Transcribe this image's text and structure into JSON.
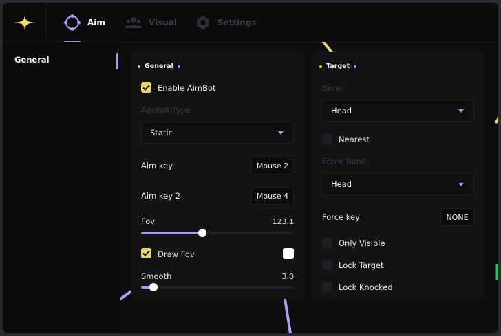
{
  "window": {
    "accent_color": "#a79de9",
    "check_color": "#e6d27a"
  },
  "tabs": [
    {
      "label": "Aim",
      "icon": "crosshair-icon",
      "active": true
    },
    {
      "label": "Visual",
      "icon": "users-icon",
      "active": false
    },
    {
      "label": "Settings",
      "icon": "gear-icon",
      "active": false
    }
  ],
  "sidebar": {
    "items": [
      {
        "label": "General",
        "active": true
      }
    ]
  },
  "general_panel": {
    "title": "General",
    "enable_aimbot": {
      "label": "Enable AimBot",
      "checked": true
    },
    "aimbot_type": {
      "label": "AimBot Type",
      "value": "Static"
    },
    "aim_key": {
      "label": "Aim key",
      "value": "Mouse 2"
    },
    "aim_key_2": {
      "label": "Aim key 2",
      "value": "Mouse 4"
    },
    "fov": {
      "label": "Fov",
      "value": "123.1",
      "fraction": 0.4
    },
    "draw_fov": {
      "label": "Draw Fov",
      "checked": true,
      "swatch_color": "#ffffff"
    },
    "smooth": {
      "label": "Smooth",
      "value": "3.0",
      "fraction": 0.08
    }
  },
  "target_panel": {
    "title": "Target",
    "bone": {
      "label": "Bone",
      "value": "Head"
    },
    "nearest": {
      "label": "Nearest",
      "checked": false
    },
    "force_bone": {
      "label": "Force Bone",
      "value": "Head"
    },
    "force_key": {
      "label": "Force key",
      "value": "NONE"
    },
    "only_visible": {
      "label": "Only Visible",
      "checked": false
    },
    "lock_target": {
      "label": "Lock Target",
      "checked": false
    },
    "lock_knocked": {
      "label": "Lock Knocked",
      "checked": false
    }
  }
}
